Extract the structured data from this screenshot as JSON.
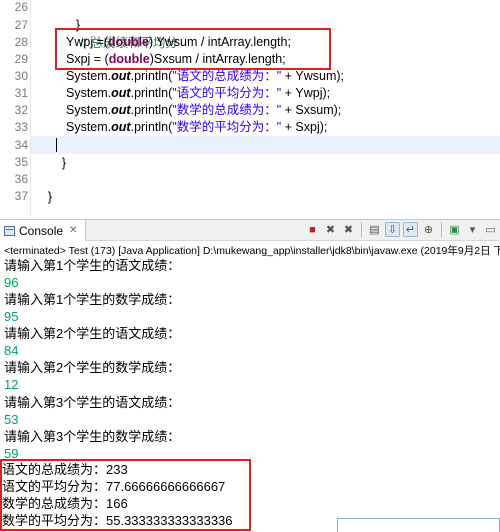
{
  "editor": {
    "lines": [
      {
        "num": "26",
        "code": "}"
      },
      {
        "num": "27",
        "comment": "// 总成绩和平均分"
      },
      {
        "num": "28",
        "lhs": "Ywpj =(",
        "kw": "double",
        "rest": ") Ywsum / intArray.length;"
      },
      {
        "num": "29",
        "lhs": "Sxpj = (",
        "kw": "double",
        "rest": ")Sxsum / intArray.length;"
      },
      {
        "num": "30",
        "pre": "System.",
        "out": "out",
        "mid": ".println(",
        "str": "\"语文的总成绩为：\"",
        "tail": " + Ywsum);"
      },
      {
        "num": "31",
        "pre": "System.",
        "out": "out",
        "mid": ".println(",
        "str": "\"语文的平均分为：\"",
        "tail": " + Ywpj);"
      },
      {
        "num": "32",
        "pre": "System.",
        "out": "out",
        "mid": ".println(",
        "str": "\"数学的总成绩为：\"",
        "tail": " + Sxsum);"
      },
      {
        "num": "33",
        "pre": "System.",
        "out": "out",
        "mid": ".println(",
        "str": "\"数学的平均分为：\"",
        "tail": " + Sxpj);"
      },
      {
        "num": "34",
        "code": "}"
      },
      {
        "num": "35",
        "code": ""
      },
      {
        "num": "36",
        "code": "}"
      },
      {
        "num": "37",
        "code": ""
      }
    ]
  },
  "console": {
    "tab_label": "Console",
    "tab_close": "✕",
    "status": "<terminated> Test (173) [Java Application] D:\\mukewang_app\\installer\\jdk8\\bin\\javaw.exe (2019年9月2日 下午6",
    "lines": [
      {
        "text": "请输入第1个学生的语文成绩：",
        "kind": "prompt"
      },
      {
        "text": "96",
        "kind": "inp"
      },
      {
        "text": "请输入第1个学生的数学成绩：",
        "kind": "prompt"
      },
      {
        "text": "95",
        "kind": "inp"
      },
      {
        "text": "请输入第2个学生的语文成绩：",
        "kind": "prompt"
      },
      {
        "text": "84",
        "kind": "inp"
      },
      {
        "text": "请输入第2个学生的数学成绩：",
        "kind": "prompt"
      },
      {
        "text": "12",
        "kind": "inp"
      },
      {
        "text": "请输入第3个学生的语文成绩：",
        "kind": "prompt"
      },
      {
        "text": "53",
        "kind": "inp"
      },
      {
        "text": "请输入第3个学生的数学成绩：",
        "kind": "prompt"
      },
      {
        "text": "59",
        "kind": "inp"
      },
      {
        "text": "语文的总成绩为：233",
        "kind": "out"
      },
      {
        "text": "语文的平均分为：77.66666666666667",
        "kind": "out"
      },
      {
        "text": "数学的总成绩为：166",
        "kind": "out"
      },
      {
        "text": "数学的平均分为：55.333333333333336",
        "kind": "out"
      }
    ]
  },
  "toolbar": {
    "icons": [
      "stop-icon",
      "remove-icon",
      "remove-all-icon",
      "clear-icon",
      "scroll-lock-icon",
      "word-wrap-icon",
      "pin-icon",
      "display-console-icon",
      "open-console-icon",
      "minimize-icon"
    ]
  },
  "colors": {
    "keyword": "#7f0055",
    "string": "#2a00ff",
    "comment": "#3f7f5f",
    "user_input": "#00a65a",
    "highlight_box": "#e02020"
  }
}
